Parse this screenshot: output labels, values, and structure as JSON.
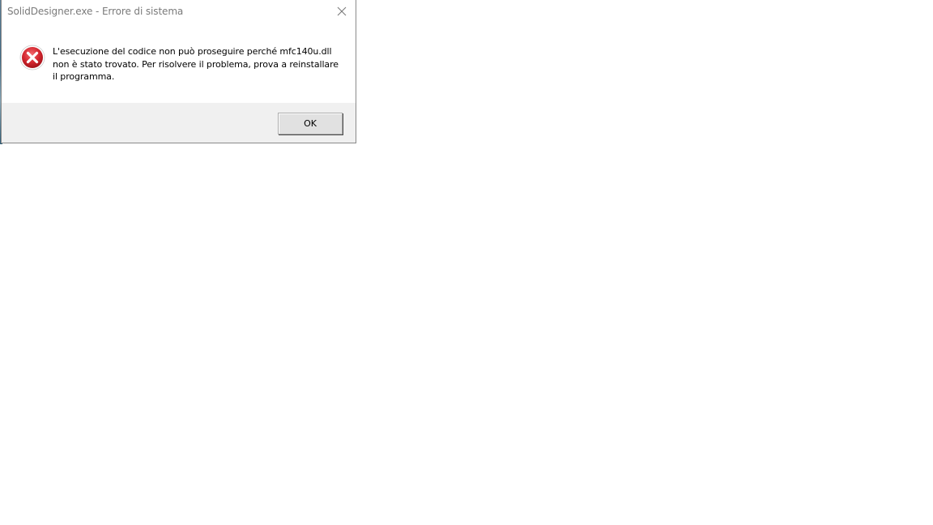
{
  "dialog": {
    "title": "SolidDesigner.exe - Errore di sistema",
    "icon": "error-icon",
    "message": "L'esecuzione del codice non può proseguire perché mfc140u.dll non è stato trovato. Per risolvere il problema, prova a reinstallare il programma.",
    "ok_label": "OK",
    "close_icon": "close-icon"
  },
  "colors": {
    "error_red": "#d3262e",
    "footer_bg": "#f0f0f0",
    "title_text": "#7a7a7a"
  }
}
